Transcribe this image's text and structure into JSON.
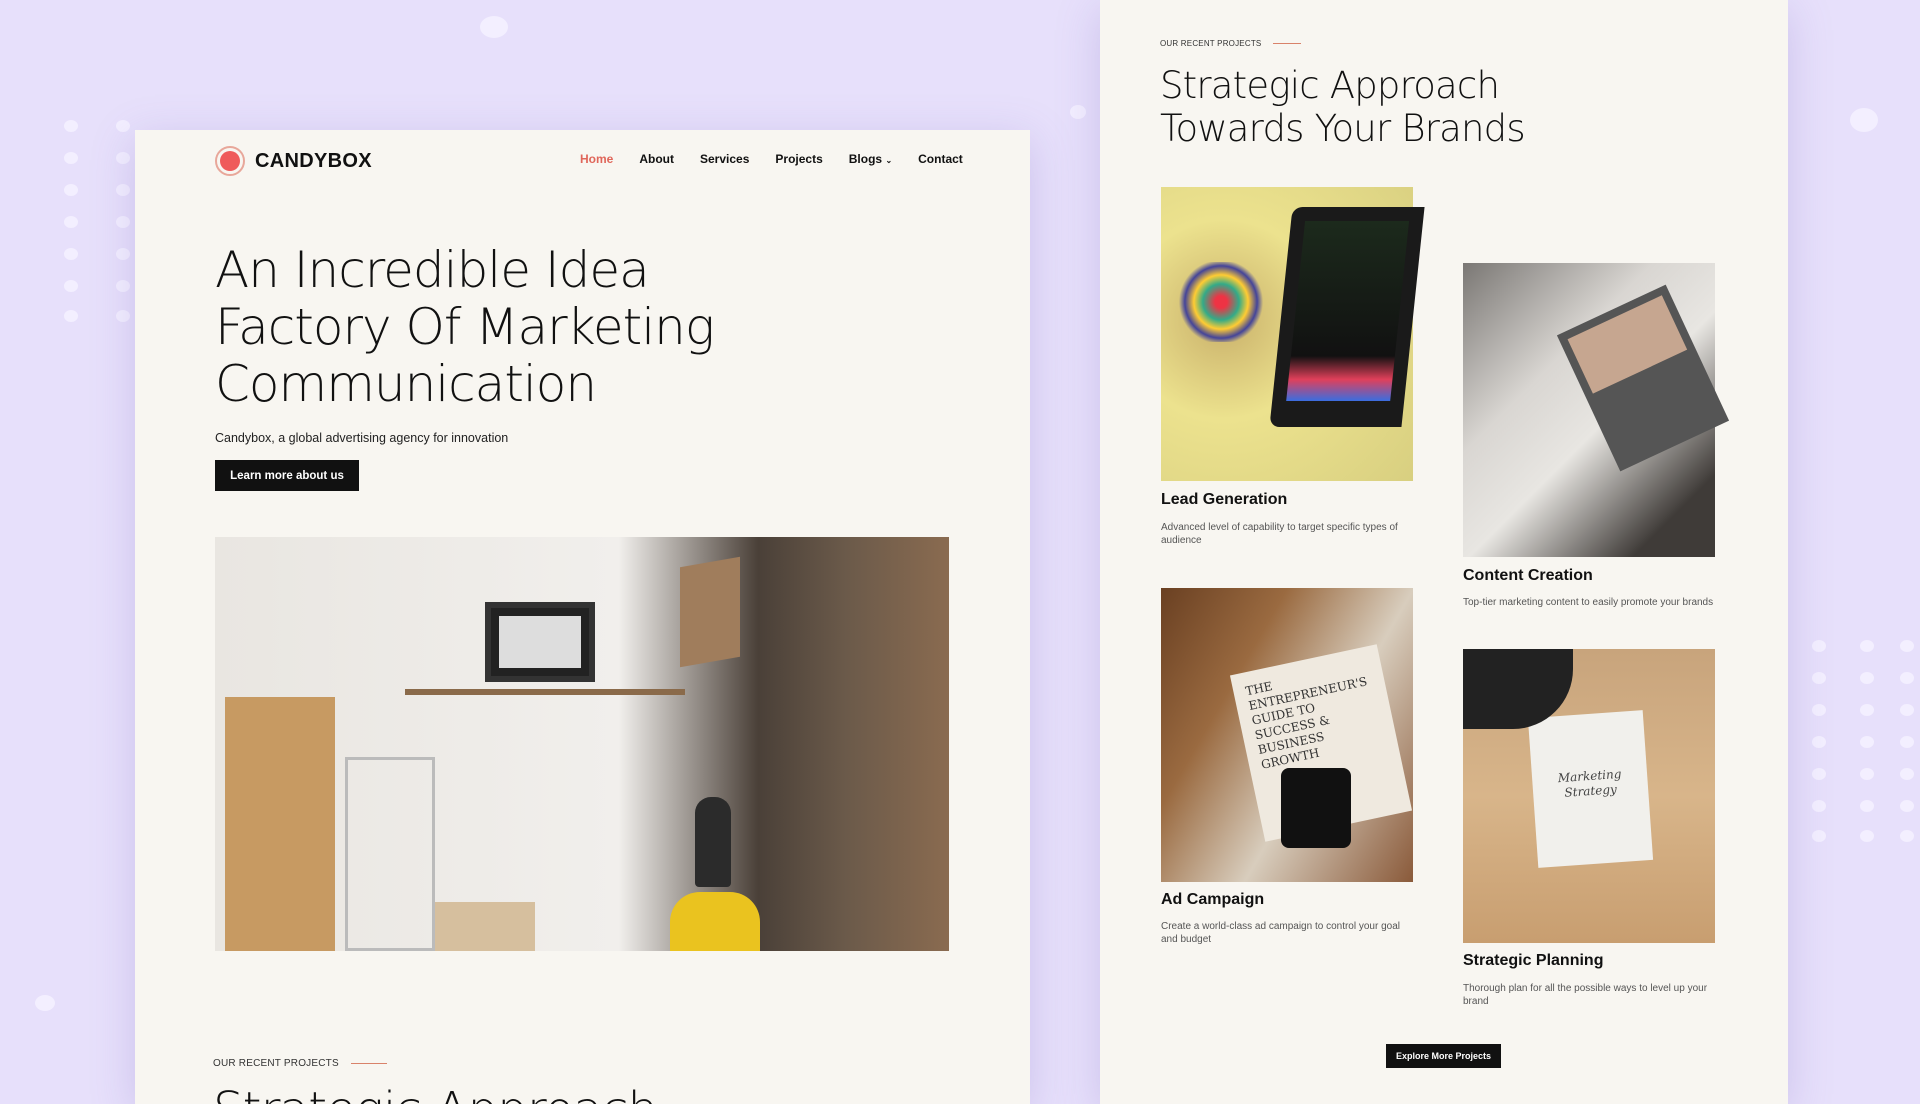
{
  "brand": {
    "name": "CANDYBOX",
    "accent": "#e8605a"
  },
  "nav": {
    "items": [
      "Home",
      "About",
      "Services",
      "Projects",
      "Blogs",
      "Contact"
    ],
    "active": "Home",
    "blogs_icon": "chevron-down-icon"
  },
  "hero": {
    "title_lines": [
      "An Incredible Idea",
      "Factory Of Marketing",
      "Communication"
    ],
    "subtitle": "Candybox, a global advertising agency for innovation",
    "cta": "Learn more about us"
  },
  "bottom_preview": {
    "label": "OUR RECENT PROJECTS",
    "heading": "Strategic Approach"
  },
  "projects": {
    "label": "OUR RECENT PROJECTS",
    "heading_lines": [
      "Strategic Approach",
      "Towards Your Brands"
    ],
    "items": [
      {
        "title": "Lead Generation",
        "desc": "Advanced level of capability to target specific types of audience"
      },
      {
        "title": "Content Creation",
        "desc": "Top-tier marketing content to easily promote your brands"
      },
      {
        "title": "Ad Campaign",
        "desc": "Create a world-class ad campaign to control your goal and budget"
      },
      {
        "title": "Strategic Planning",
        "desc": "Thorough plan for all the possible ways to level up your brand"
      }
    ],
    "image_text": {
      "book": "THE ENTREPRENEUR'S GUIDE TO SUCCESS & BUSINESS GROWTH",
      "paper": "Marketing Strategy"
    },
    "cta": "Explore More Projects"
  }
}
